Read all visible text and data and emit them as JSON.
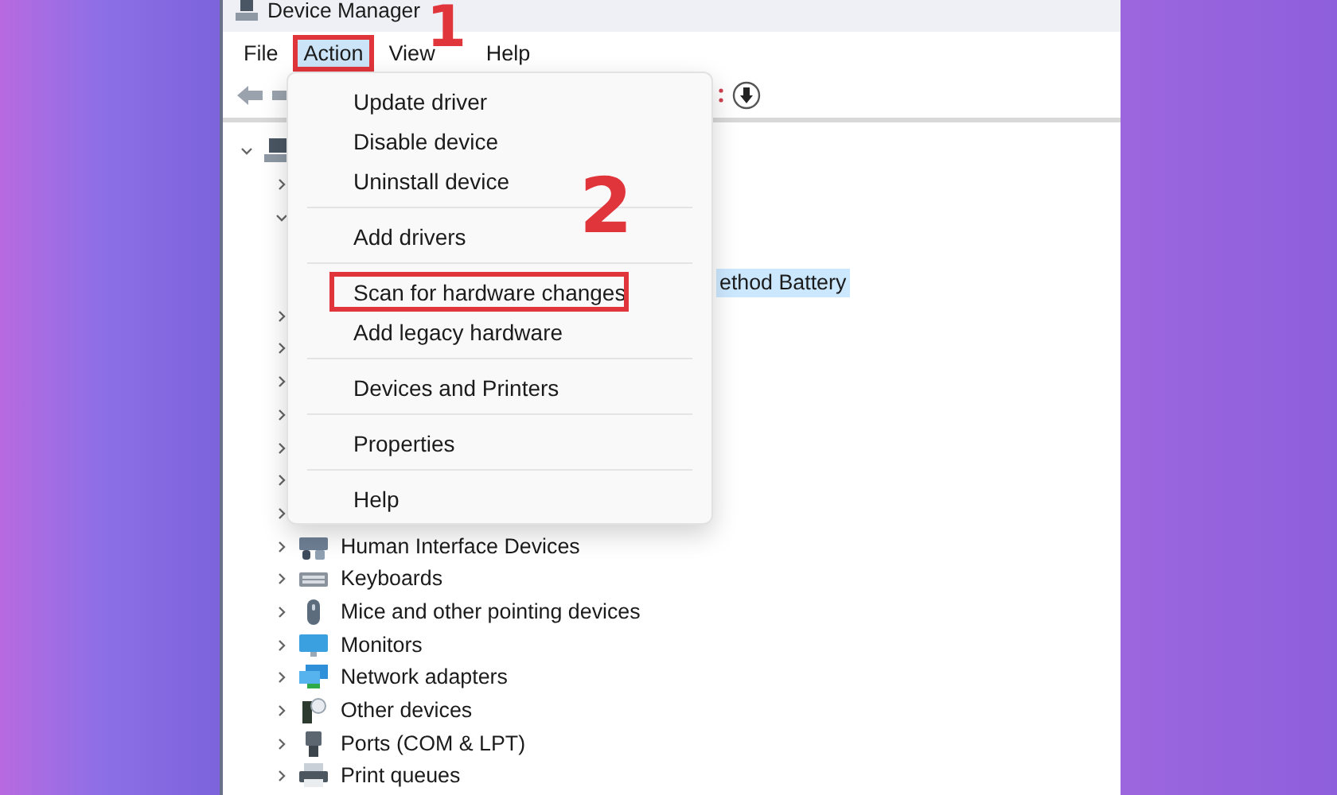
{
  "window": {
    "title": "Device Manager"
  },
  "menu_bar": [
    {
      "label": "File",
      "selected": false,
      "outlined": false
    },
    {
      "label": "Action",
      "selected": true,
      "outlined": true
    },
    {
      "label": "View",
      "selected": false,
      "outlined": false
    },
    {
      "label": "Help",
      "selected": false,
      "outlined": false
    }
  ],
  "dropdown": {
    "groups": [
      [
        {
          "label": "Update driver",
          "outlined": false
        },
        {
          "label": "Disable device",
          "outlined": false
        },
        {
          "label": "Uninstall device",
          "outlined": false
        }
      ],
      [
        {
          "label": "Add drivers",
          "outlined": false
        }
      ],
      [
        {
          "label": "Scan for hardware changes",
          "outlined": true
        },
        {
          "label": "Add legacy hardware",
          "outlined": false
        }
      ],
      [
        {
          "label": "Devices and Printers",
          "outlined": false
        }
      ],
      [
        {
          "label": "Properties",
          "outlined": false
        }
      ],
      [
        {
          "label": "Help",
          "outlined": false
        }
      ]
    ]
  },
  "annotations": [
    {
      "text": "1"
    },
    {
      "text": "2"
    }
  ],
  "tree": {
    "expanded": true,
    "children": [
      {
        "expanded": false
      },
      {
        "expanded": true,
        "children": [
          {
            "label": "ethod Battery",
            "selected": true
          }
        ]
      },
      {
        "expanded": false
      },
      {
        "expanded": false
      },
      {
        "expanded": false
      },
      {
        "expanded": false
      },
      {
        "expanded": false
      },
      {
        "expanded": false
      },
      {
        "expanded": false
      },
      {
        "label": "Human Interface Devices",
        "expanded": false
      },
      {
        "label": "Keyboards",
        "expanded": false
      },
      {
        "label": "Mice and other pointing devices",
        "expanded": false
      },
      {
        "label": "Monitors",
        "expanded": false
      },
      {
        "label": "Network adapters",
        "expanded": false
      },
      {
        "label": "Other devices",
        "expanded": false
      },
      {
        "label": "Ports (COM & LPT)",
        "expanded": false
      },
      {
        "label": "Print queues",
        "expanded": false
      }
    ]
  }
}
